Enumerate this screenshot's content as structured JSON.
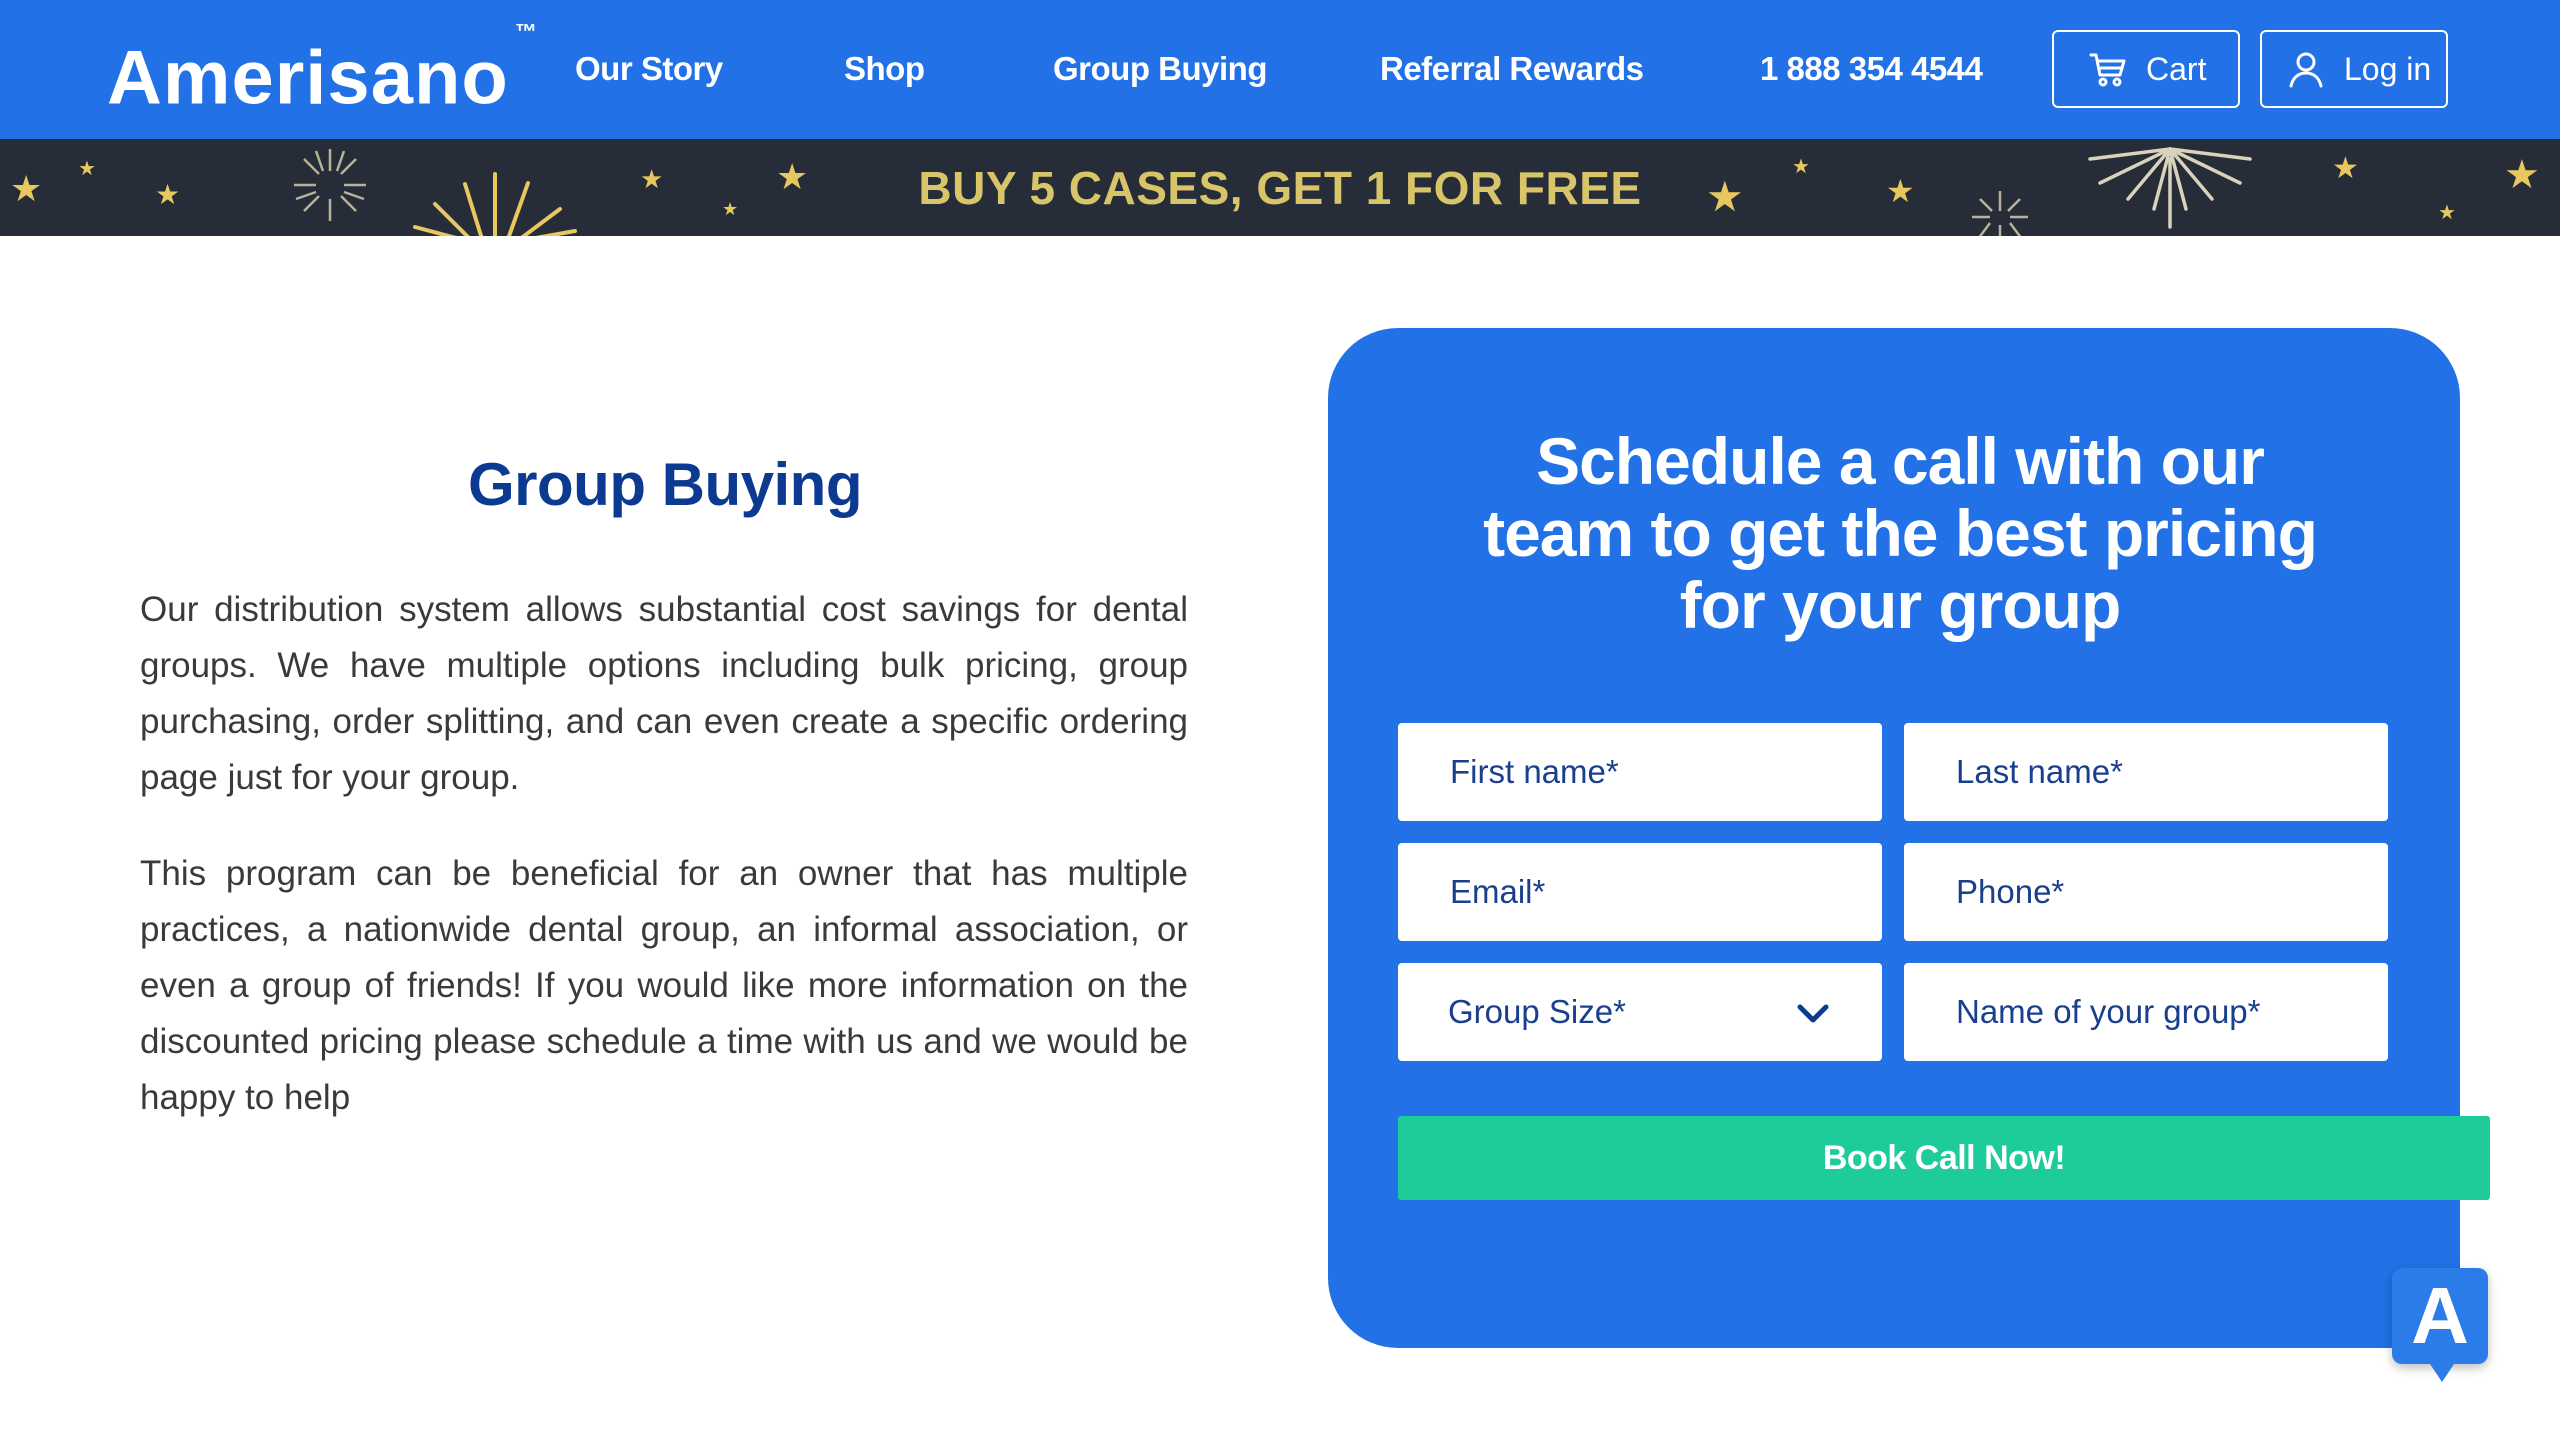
{
  "header": {
    "logo": "Amerisano",
    "logo_mark": "™",
    "nav": [
      {
        "label": "Our Story"
      },
      {
        "label": "Shop"
      },
      {
        "label": "Group Buying"
      },
      {
        "label": "Referral Rewards"
      },
      {
        "label": "1 888 354 4544"
      }
    ],
    "cart_label": "Cart",
    "cart_icon": "cart-icon",
    "login_label": "Log in",
    "login_icon": "user-icon"
  },
  "promo": {
    "text": "BUY 5 CASES, GET 1 FOR FREE"
  },
  "content": {
    "title": "Group Buying",
    "paragraphs": [
      "Our distribution system allows substantial cost savings for dental groups. We have multiple options including bulk pricing, group purchasing, order splitting, and can even create a specific ordering page just for your group.",
      "This program can be beneficial for an owner that has multiple practices, a nationwide dental group, an informal association, or even a group of friends! If you would like more information on the discounted pricing please schedule a time with us and we would be happy to help"
    ]
  },
  "form": {
    "title_lines": [
      "Schedule a call with our",
      "team to get the best pricing",
      "for your group"
    ],
    "first_name": "First name*",
    "last_name": "Last name*",
    "email": "Email*",
    "phone": "Phone*",
    "group_size": "Group Size*",
    "group_name": "Name of your group*",
    "submit": "Book Call Now!"
  },
  "accessibility": {
    "label": "A"
  },
  "colors": {
    "brand_blue": "#2271e6",
    "banner_dark": "#262d38",
    "gold": "#d8c56a",
    "cta_green": "#1ecc9b",
    "heading_navy": "#0d3a91"
  }
}
